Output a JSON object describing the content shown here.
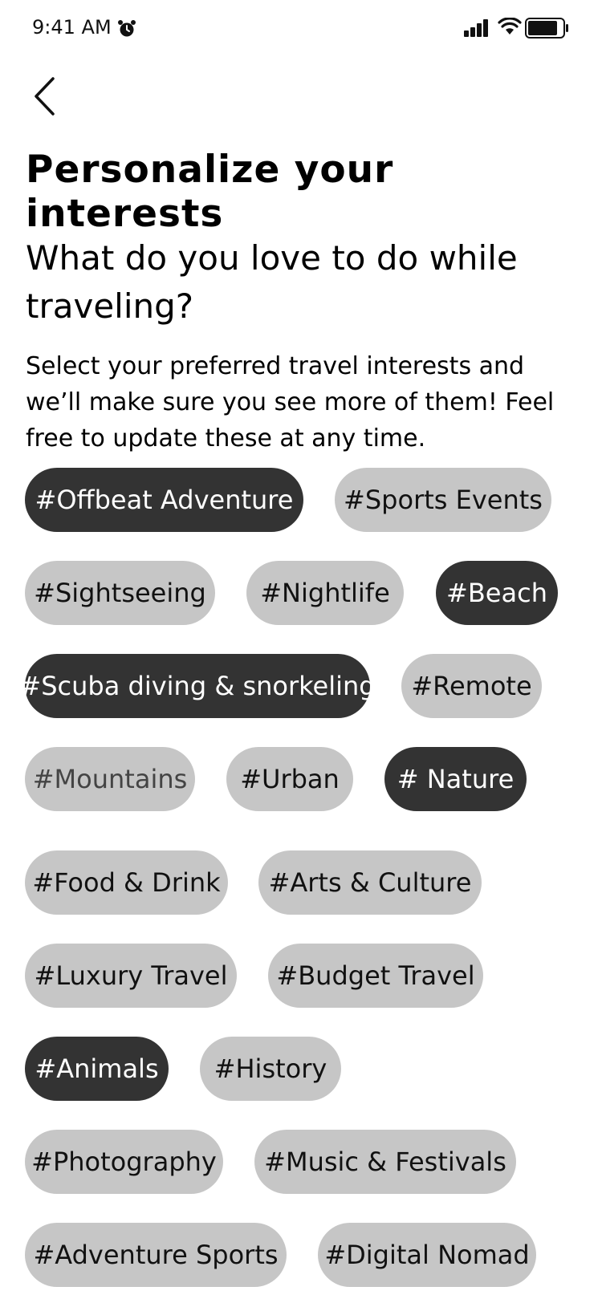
{
  "status_bar": {
    "time": "9:41 AM",
    "icons": [
      "alarm-icon",
      "signal-icon",
      "wifi-icon",
      "battery-icon"
    ]
  },
  "nav": {
    "back_icon": "chevron-left-icon"
  },
  "header": {
    "title": "Personalize your interests"
  },
  "main": {
    "question": "What do you love to do while traveling?",
    "description": "Select your preferred travel interests and we’ll make sure you see more of them! Feel free to update these at any time."
  },
  "colors": {
    "selected_chip": "#333333",
    "unselected_chip": "#c6c6c6",
    "background": "#ffffff"
  },
  "tags": [
    {
      "label": "#Offbeat Adventure",
      "selected": true
    },
    {
      "label": "#Sports Events",
      "selected": false
    },
    {
      "label": "#Sightseeing",
      "selected": false
    },
    {
      "label": "#Nightlife",
      "selected": false
    },
    {
      "label": "#Beach",
      "selected": true
    },
    {
      "label": "#Scuba diving & snorkeling",
      "selected": true
    },
    {
      "label": "#Remote",
      "selected": false
    },
    {
      "label": "#Mountains",
      "selected": false
    },
    {
      "label": "#Urban",
      "selected": false
    },
    {
      "label": "# Nature",
      "selected": true
    },
    {
      "label": "#Food & Drink",
      "selected": false
    },
    {
      "label": "#Arts & Culture",
      "selected": false
    },
    {
      "label": "#Luxury Travel",
      "selected": false
    },
    {
      "label": "#Budget Travel",
      "selected": false
    },
    {
      "label": "#Animals",
      "selected": true
    },
    {
      "label": "#History",
      "selected": false
    },
    {
      "label": "#Photography",
      "selected": false
    },
    {
      "label": "#Music &  Festivals",
      "selected": false
    },
    {
      "label": "#Adventure Sports",
      "selected": false
    },
    {
      "label": "#Digital Nomad",
      "selected": false
    }
  ]
}
